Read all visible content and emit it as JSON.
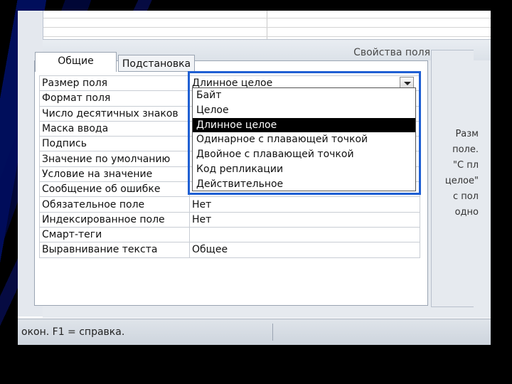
{
  "properties_header": "Свойства поля",
  "tabs": [
    {
      "label": "Общие",
      "active": true
    },
    {
      "label": "Подстановка",
      "active": false
    }
  ],
  "rows": [
    {
      "label": "Размер поля",
      "value": "Длинное целое"
    },
    {
      "label": "Формат поля",
      "value": ""
    },
    {
      "label": "Число десятичных знаков",
      "value": ""
    },
    {
      "label": "Маска ввода",
      "value": ""
    },
    {
      "label": "Подпись",
      "value": ""
    },
    {
      "label": "Значение по умолчанию",
      "value": ""
    },
    {
      "label": "Условие на значение",
      "value": ""
    },
    {
      "label": "Сообщение об ошибке",
      "value": ""
    },
    {
      "label": "Обязательное поле",
      "value": "Нет"
    },
    {
      "label": "Индексированное поле",
      "value": "Нет"
    },
    {
      "label": "Смарт-теги",
      "value": ""
    },
    {
      "label": "Выравнивание текста",
      "value": "Общее"
    }
  ],
  "dropdown": {
    "options": [
      "Байт",
      "Целое",
      "Длинное целое",
      "Одинарное с плавающей точкой",
      "Двойное с плавающей точкой",
      "Код репликации",
      "Действительное"
    ],
    "selected": "Длинное целое"
  },
  "help_text_lines": [
    "Разм",
    "поле.",
    "\"С пл",
    "целое\"",
    "с пол",
    "одно"
  ],
  "status_text": "окон.  F1 = справка.",
  "colors": {
    "highlight_frame": "#1f5fd3",
    "selected_option_bg": "#000000"
  }
}
